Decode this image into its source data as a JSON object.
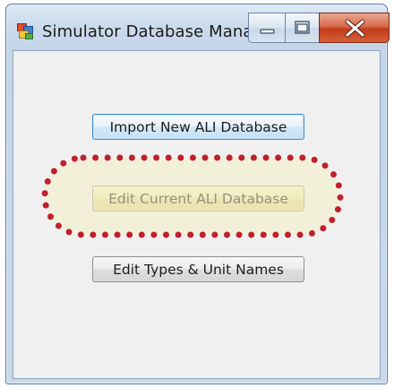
{
  "window": {
    "title": "Simulator Database Mana...",
    "app_icon": "app-window-icon"
  },
  "caption_buttons": {
    "minimize_icon": "minimize-icon",
    "maximize_icon": "maximize-icon",
    "close_icon": "close-icon"
  },
  "buttons": {
    "import_label": "Import New ALI Database",
    "edit_current_label": "Edit Current ALI Database",
    "edit_types_label": "Edit Types & Unit Names"
  },
  "highlight": {
    "target": "edit-current-ali-database-button",
    "style": "dotted-rounded",
    "dot_color": "#c0202c",
    "fill_color": "#f5f0c8"
  },
  "colors": {
    "accent_border": "#3c8dcb",
    "close_red": "#c23b18",
    "client_bg": "#f0f0f0"
  }
}
